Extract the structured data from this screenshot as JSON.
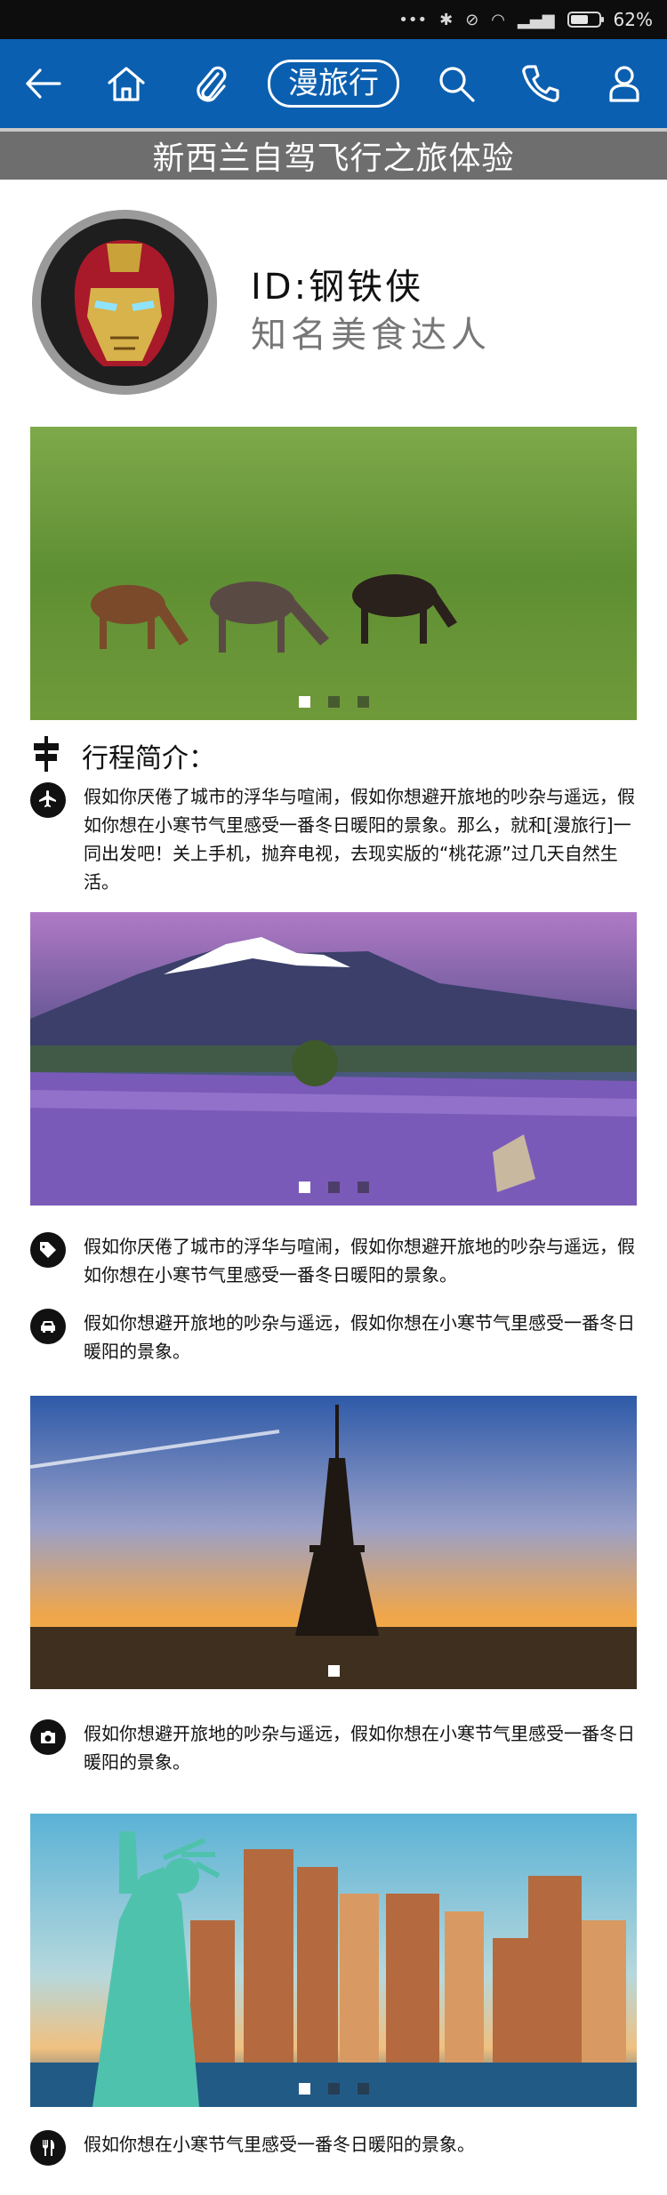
{
  "status": {
    "battery": "62%",
    "battery_level": 0.62
  },
  "header": {
    "brand": "漫旅行",
    "icons": [
      "back-icon",
      "home-icon",
      "paperclip-icon",
      "search-icon",
      "phone-icon",
      "user-icon"
    ]
  },
  "page_title": "新西兰自驾飞行之旅体验",
  "profile": {
    "id": "ID:钢铁侠",
    "subtitle": "知名美食达人"
  },
  "sections": {
    "intro_title": "行程简介：",
    "items": [
      {
        "icon": "airplane-icon",
        "text": "假如你厌倦了城市的浮华与喧闹，假如你想避开旅地的吵杂与遥远，假如你想在小寒节气里感受一番冬日暖阳的景象。那么，就和[漫旅行]一同出发吧！关上手机，抛弃电视，去现实版的“桃花源”过几天自然生活。"
      },
      {
        "icon": "tag-icon",
        "text": "假如你厌倦了城市的浮华与喧闹，假如你想避开旅地的吵杂与遥远，假如你想在小寒节气里感受一番冬日暖阳的景象。"
      },
      {
        "icon": "car-icon",
        "text": "假如你想避开旅地的吵杂与遥远，假如你想在小寒节气里感受一番冬日暖阳的景象。"
      },
      {
        "icon": "camera-icon",
        "text": "假如你想避开旅地的吵杂与遥远，假如你想在小寒节气里感受一番冬日暖阳的景象。"
      },
      {
        "icon": "cutlery-icon",
        "text": "假如你想在小寒节气里感受一番冬日暖阳的景象。"
      }
    ]
  },
  "carousels": [
    {
      "scene": "horses-on-grassland",
      "dot_count": 3,
      "active_dot": 0
    },
    {
      "scene": "snow-mountain-lavender-field",
      "dot_count": 3,
      "active_dot": 0
    },
    {
      "scene": "eiffel-tower-sunset",
      "dot_count": 1,
      "active_dot": 0
    },
    {
      "scene": "statue-of-liberty-skyline",
      "dot_count": 3,
      "active_dot": 0
    }
  ],
  "colors": {
    "header_blue": "#0a5fb0",
    "title_bar_gray": "#6e6e6e",
    "status_bar": "#0d0d0d"
  }
}
